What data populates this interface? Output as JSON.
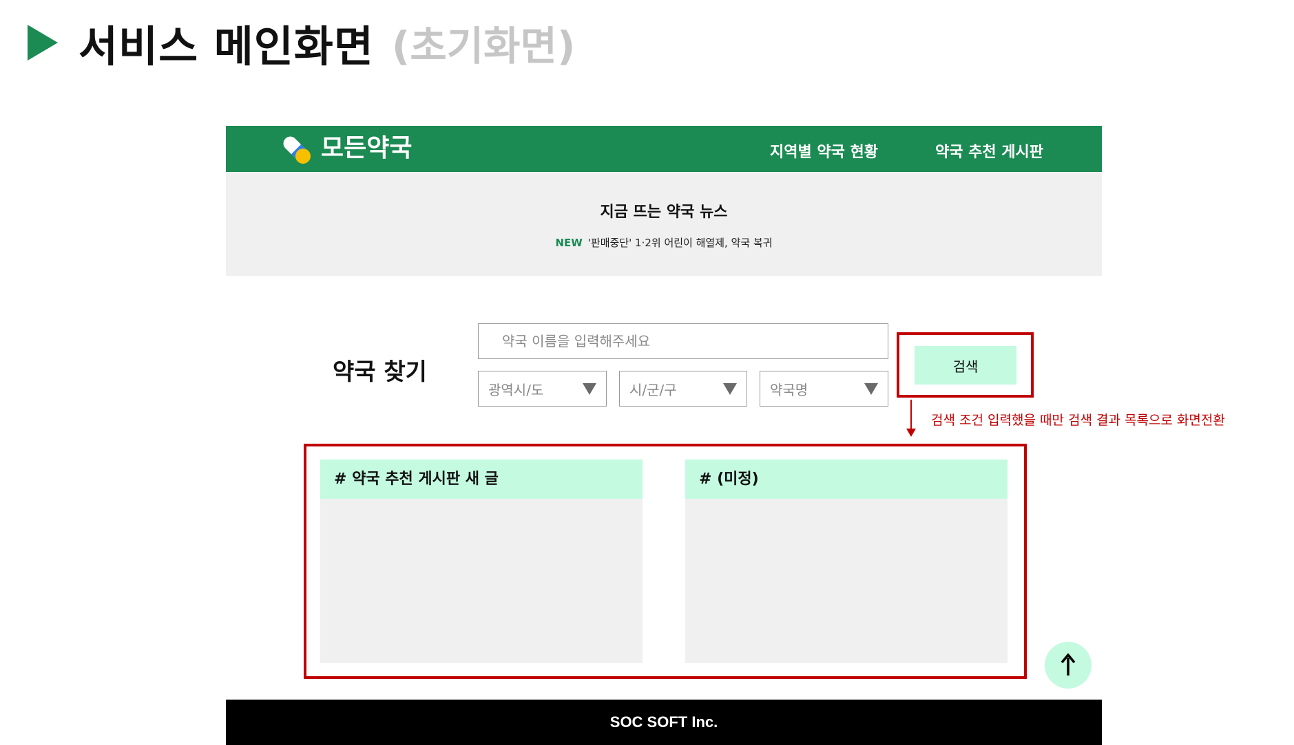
{
  "slide": {
    "title": "서비스 메인화면",
    "subtitle": "(초기화면)"
  },
  "header": {
    "brand": "모든약국",
    "nav": [
      "지역별 약국 현황",
      "약국 추천 게시판"
    ]
  },
  "news": {
    "title": "지금 뜨는 약국 뉴스",
    "badge": "NEW",
    "headline": "'판매중단' 1·2위 어린이 해열제, 약국 복귀"
  },
  "search": {
    "label": "약국 찾기",
    "placeholder": "약국 이름을 입력해주세요",
    "selects": [
      "광역시/도",
      "시/군/구",
      "약국명"
    ],
    "button": "검색"
  },
  "annotation": "검색 조건 입력했을 때만 검색 결과 목록으로 화면전환",
  "boards": [
    "# 약국 추천 게시판 새 글",
    "# (미정)"
  ],
  "top_button": "↑",
  "footer": "SOC SOFT Inc.",
  "colors": {
    "brand_green": "#1b8a53",
    "mint": "#c3fae0",
    "annotation_red": "#c00000"
  },
  "icons": {
    "logo": "pill-capsule-icon",
    "bullet": "play-triangle-icon",
    "dropdown": "caret-down-icon",
    "top": "arrow-up-icon"
  }
}
